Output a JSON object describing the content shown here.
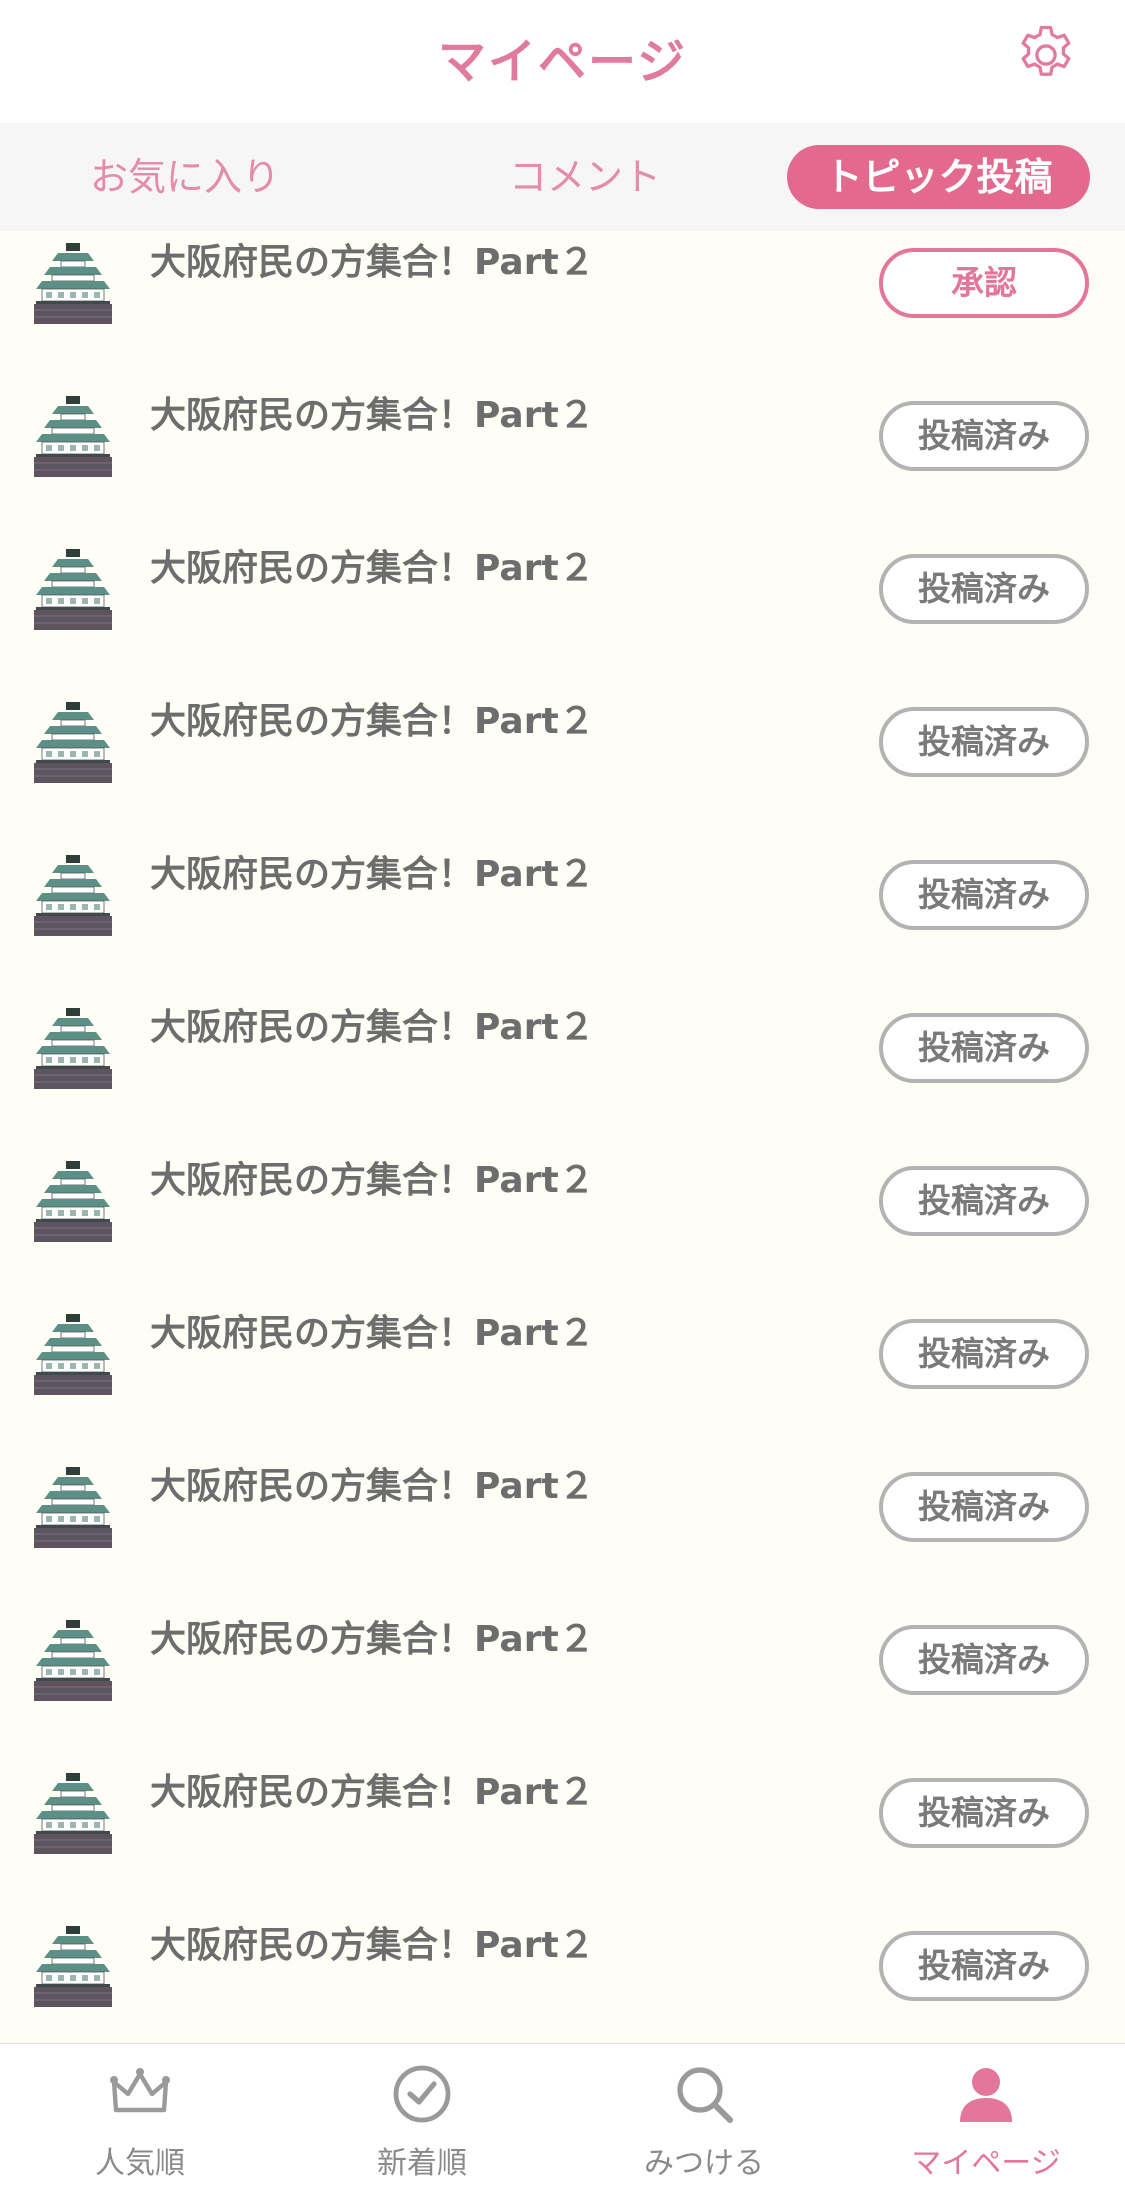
{
  "header": {
    "title": "マイページ",
    "settings_icon": "gear-icon",
    "accent_color": "#e07b9b"
  },
  "tabs": [
    {
      "label": "お気に入り",
      "active": false
    },
    {
      "label": "コメント",
      "active": false
    },
    {
      "label": "トピック投稿",
      "active": true
    }
  ],
  "topics": [
    {
      "title": "大阪府民の方集合！Part２",
      "status": "承認",
      "thumbnail_icon": "osaka-castle-icon"
    },
    {
      "title": "大阪府民の方集合！Part２",
      "status": "投稿済み",
      "thumbnail_icon": "osaka-castle-icon"
    },
    {
      "title": "大阪府民の方集合！Part２",
      "status": "投稿済み",
      "thumbnail_icon": "osaka-castle-icon"
    },
    {
      "title": "大阪府民の方集合！Part２",
      "status": "投稿済み",
      "thumbnail_icon": "osaka-castle-icon"
    },
    {
      "title": "大阪府民の方集合！Part２",
      "status": "投稿済み",
      "thumbnail_icon": "osaka-castle-icon"
    },
    {
      "title": "大阪府民の方集合！Part２",
      "status": "投稿済み",
      "thumbnail_icon": "osaka-castle-icon"
    },
    {
      "title": "大阪府民の方集合！Part２",
      "status": "投稿済み",
      "thumbnail_icon": "osaka-castle-icon"
    },
    {
      "title": "大阪府民の方集合！Part２",
      "status": "投稿済み",
      "thumbnail_icon": "osaka-castle-icon"
    },
    {
      "title": "大阪府民の方集合！Part２",
      "status": "投稿済み",
      "thumbnail_icon": "osaka-castle-icon"
    },
    {
      "title": "大阪府民の方集合！Part２",
      "status": "投稿済み",
      "thumbnail_icon": "osaka-castle-icon"
    },
    {
      "title": "大阪府民の方集合！Part２",
      "status": "投稿済み",
      "thumbnail_icon": "osaka-castle-icon"
    },
    {
      "title": "大阪府民の方集合！Part２",
      "status": "投稿済み",
      "thumbnail_icon": "osaka-castle-icon"
    }
  ],
  "bottom_nav": [
    {
      "label": "人気順",
      "icon": "crown-icon",
      "active": false
    },
    {
      "label": "新着順",
      "icon": "clock-icon",
      "active": false
    },
    {
      "label": "みつける",
      "icon": "search-icon",
      "active": false
    },
    {
      "label": "マイページ",
      "icon": "user-icon",
      "active": true
    }
  ],
  "colors": {
    "accent": "#e3698f",
    "button_border": "#b3b3b3",
    "list_background": "#fffef6"
  }
}
